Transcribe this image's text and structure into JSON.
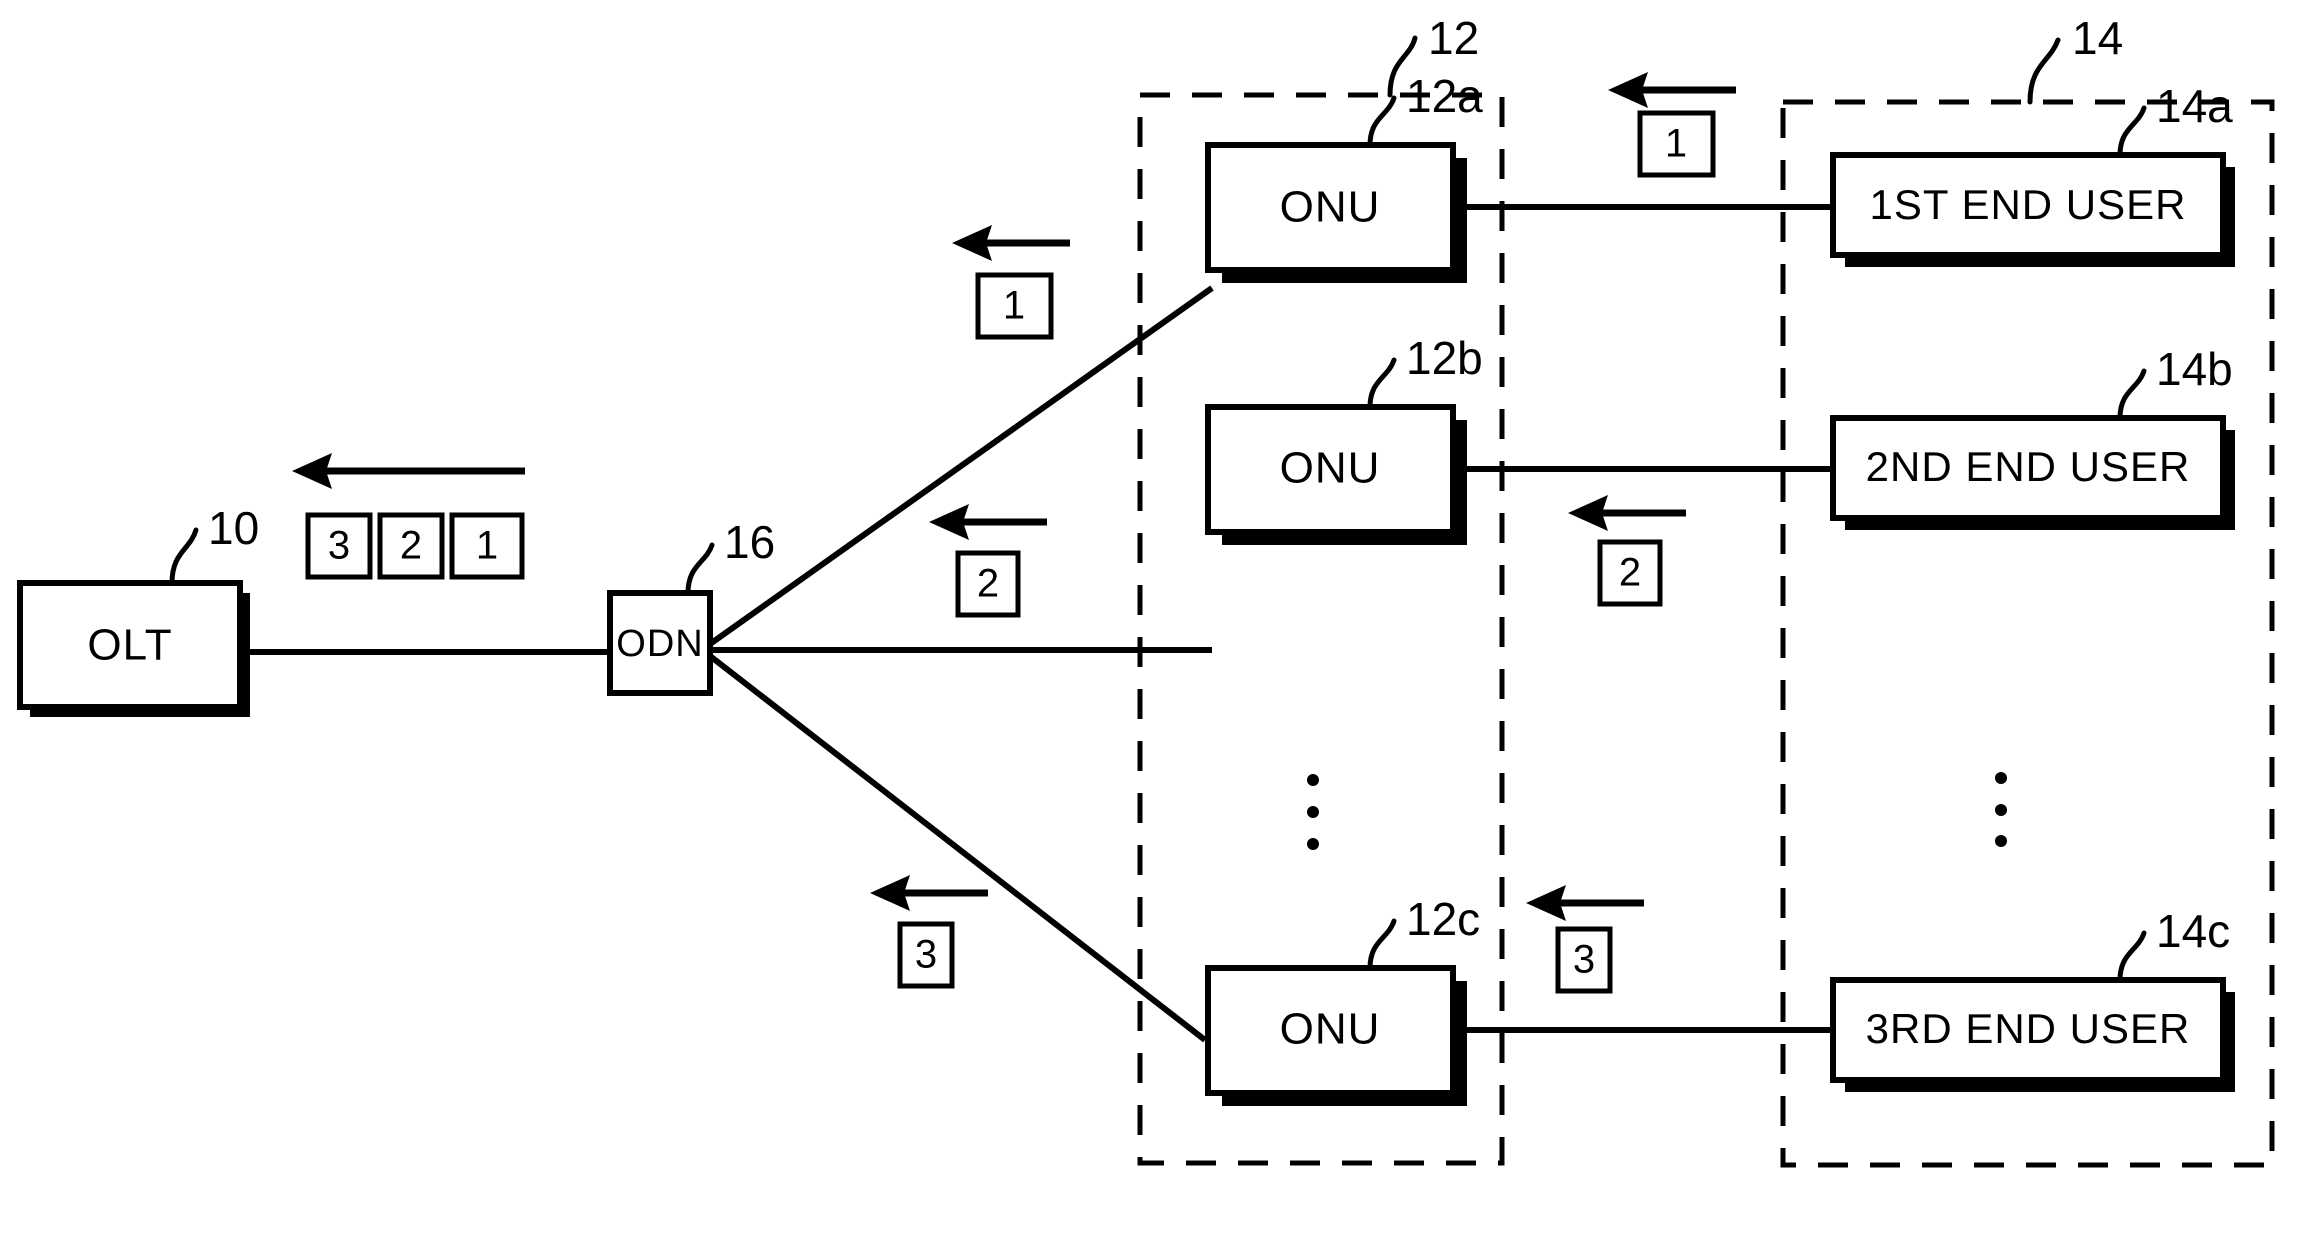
{
  "figure": {
    "title": "PON downstream packet distribution diagram",
    "background_color": "#ffffff",
    "line_color": "#000000"
  },
  "nodes": {
    "olt": {
      "label": "OLT",
      "ref": "10"
    },
    "odn": {
      "label": "ODN",
      "ref": "16"
    },
    "onu_a": {
      "label": "ONU",
      "ref": "12a"
    },
    "onu_b": {
      "label": "ONU",
      "ref": "12b"
    },
    "onu_c": {
      "label": "ONU",
      "ref": "12c"
    },
    "user_a": {
      "label": "1ST END USER",
      "ref": "14a"
    },
    "user_b": {
      "label": "2ND END USER",
      "ref": "14b"
    },
    "user_c": {
      "label": "3RD END USER",
      "ref": "14c"
    }
  },
  "regions": {
    "onu_group": {
      "ref": "12"
    },
    "user_group": {
      "ref": "14"
    }
  },
  "packets": {
    "trunk": [
      "3",
      "2",
      "1"
    ],
    "branch_a": "1",
    "branch_b": "2",
    "branch_c": "3",
    "drop_a": "1",
    "drop_b": "2",
    "drop_c": "3"
  },
  "ellipsis": {
    "onu_column": "⋮",
    "user_column": "⋮"
  }
}
